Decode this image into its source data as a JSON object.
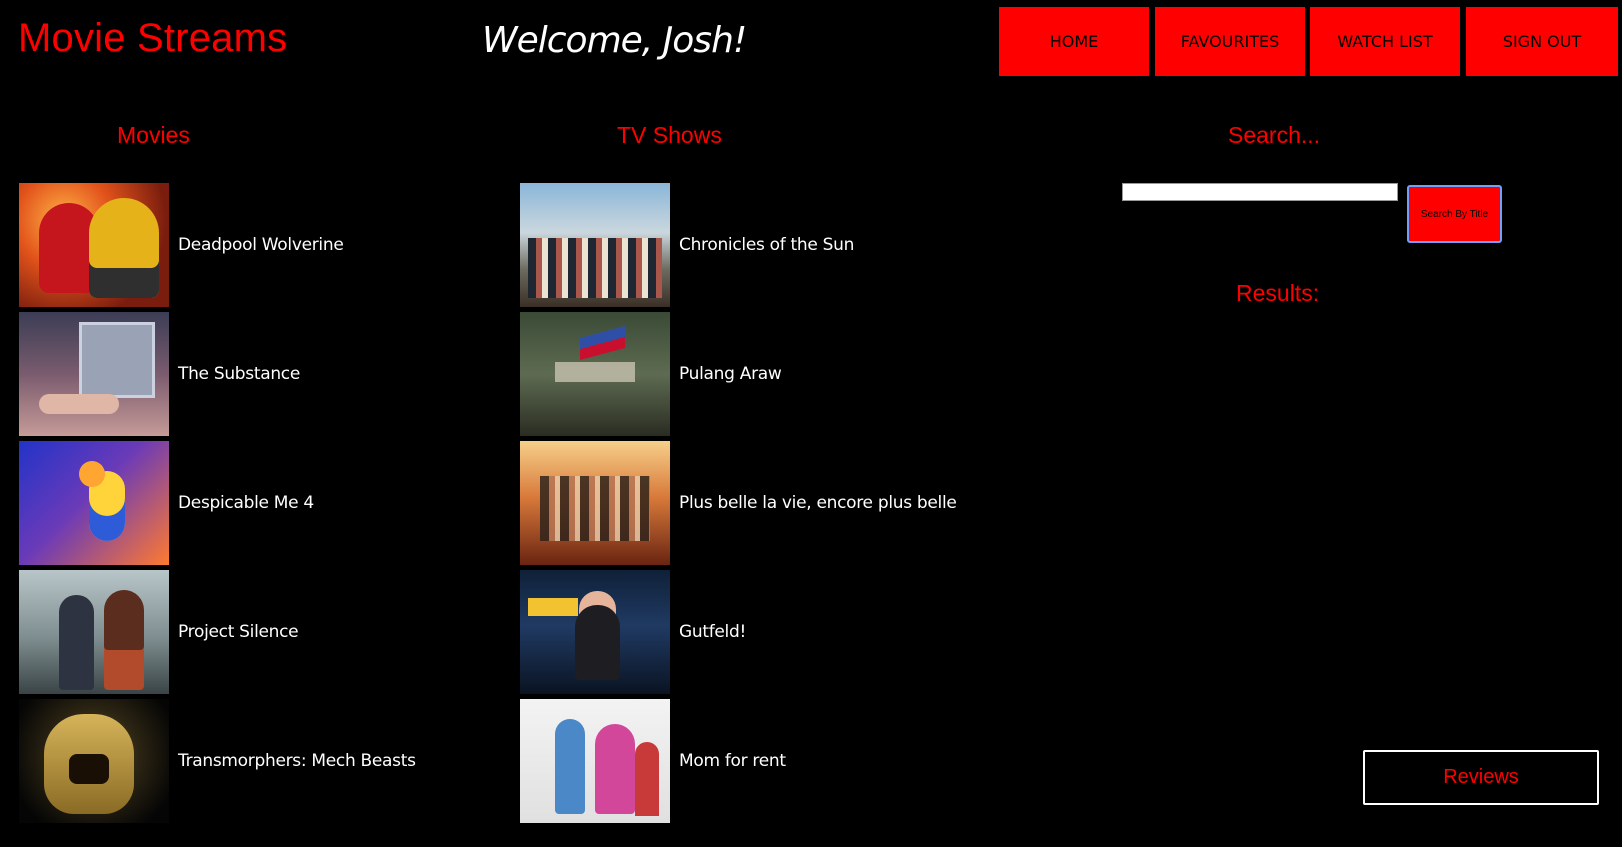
{
  "header": {
    "brand": "Movie Streams",
    "welcome": "Welcome, Josh!"
  },
  "nav": {
    "home": "HOME",
    "favourites": "FAVOURITES",
    "watch_list": "WATCH LIST",
    "sign_out": "SIGN OUT"
  },
  "sections": {
    "movies": "Movies",
    "tv_shows": "TV Shows",
    "search": "Search..."
  },
  "movies": [
    {
      "title": "Deadpool  Wolverine"
    },
    {
      "title": "The Substance"
    },
    {
      "title": "Despicable Me 4"
    },
    {
      "title": "Project Silence"
    },
    {
      "title": "Transmorphers: Mech Beasts"
    }
  ],
  "tv_shows": [
    {
      "title": "Chronicles of the Sun"
    },
    {
      "title": "Pulang Araw"
    },
    {
      "title": "Plus belle la vie, encore plus belle"
    },
    {
      "title": "Gutfeld!"
    },
    {
      "title": "Mom for rent"
    }
  ],
  "search": {
    "value": "",
    "placeholder": "",
    "button_label": "Search By Title",
    "results_label": "Results:"
  },
  "footer": {
    "reviews_label": "Reviews"
  },
  "colors": {
    "accent": "#ff0000",
    "background": "#000000",
    "text": "#ffffff"
  }
}
